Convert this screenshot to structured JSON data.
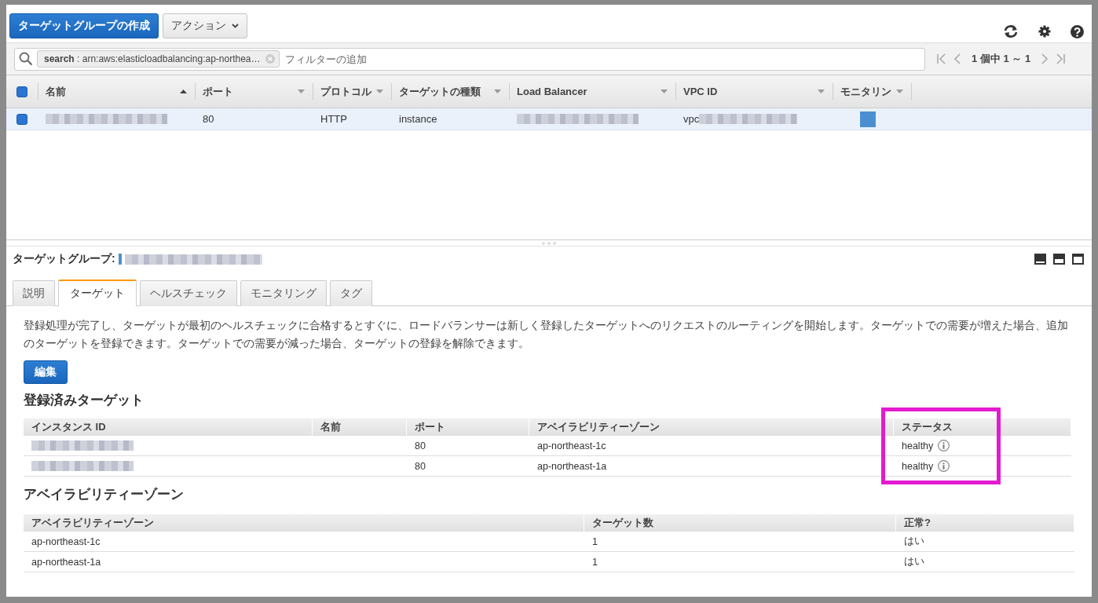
{
  "toolbar": {
    "create_button": "ターゲットグループの作成",
    "actions_button": "アクション"
  },
  "filter": {
    "token_key": "search",
    "token_value": " : arn:aws:elasticloadbalancing:ap-northea…",
    "placeholder": "フィルターの追加"
  },
  "pagination": {
    "text": "1 個中 1 ～ 1"
  },
  "table": {
    "columns": [
      {
        "label": "名前",
        "sorted": true
      },
      {
        "label": "ポート",
        "sorted": false
      },
      {
        "label": "プロトコル",
        "sorted": false
      },
      {
        "label": "ターゲットの種類",
        "sorted": false
      },
      {
        "label": "Load Balancer",
        "sorted": false
      },
      {
        "label": "VPC ID",
        "sorted": false
      },
      {
        "label": "モニタリン",
        "sorted": false
      }
    ],
    "all_checked": true,
    "rows": [
      {
        "selected": true,
        "cells": [
          {
            "kind": "redacted"
          },
          {
            "kind": "text",
            "text": "80"
          },
          {
            "kind": "text",
            "text": "HTTP"
          },
          {
            "kind": "text",
            "text": "instance"
          },
          {
            "kind": "redacted"
          },
          {
            "kind": "prefixed",
            "text": "vpc"
          },
          {
            "kind": "monitor"
          }
        ]
      }
    ]
  },
  "detail": {
    "title": "ターゲットグループ:",
    "tabs": [
      {
        "label": "説明",
        "selected": false
      },
      {
        "label": "ターゲット",
        "selected": true
      },
      {
        "label": "ヘルスチェック",
        "selected": false
      },
      {
        "label": "モニタリング",
        "selected": false
      },
      {
        "label": "タグ",
        "selected": false
      }
    ],
    "description": "登録処理が完了し、ターゲットが最初のヘルスチェックに合格するとすぐに、ロードバランサーは新しく登録したターゲットへのリクエストのルーティングを開始します。ターゲットでの需要が増えた場合、追加のターゲットを登録できます。ターゲットでの需要が減った場合、ターゲットの登録を解除できます。",
    "edit_button": "編集",
    "registered": {
      "heading": "登録済みターゲット",
      "columns": [
        {
          "label": "インスタンス ID",
          "highlighted": false
        },
        {
          "label": "名前",
          "highlighted": false
        },
        {
          "label": "ポート",
          "highlighted": false
        },
        {
          "label": "アベイラビリティーゾーン",
          "highlighted": false
        },
        {
          "label": "ステータス",
          "highlighted": true
        }
      ],
      "rows": [
        [
          {
            "kind": "redacted"
          },
          {
            "kind": "empty"
          },
          {
            "kind": "text",
            "text": "80"
          },
          {
            "kind": "text",
            "text": "ap-northeast-1c"
          },
          {
            "kind": "status",
            "text": "healthy"
          }
        ],
        [
          {
            "kind": "redacted"
          },
          {
            "kind": "empty"
          },
          {
            "kind": "text",
            "text": "80"
          },
          {
            "kind": "text",
            "text": "ap-northeast-1a"
          },
          {
            "kind": "status",
            "text": "healthy"
          }
        ]
      ]
    },
    "zones": {
      "heading": "アベイラビリティーゾーン",
      "columns": [
        "アベイラビリティーゾーン",
        "ターゲット数",
        "正常?"
      ],
      "rows": [
        [
          "ap-northeast-1c",
          "1",
          "はい"
        ],
        [
          "ap-northeast-1a",
          "1",
          "はい"
        ]
      ]
    }
  }
}
